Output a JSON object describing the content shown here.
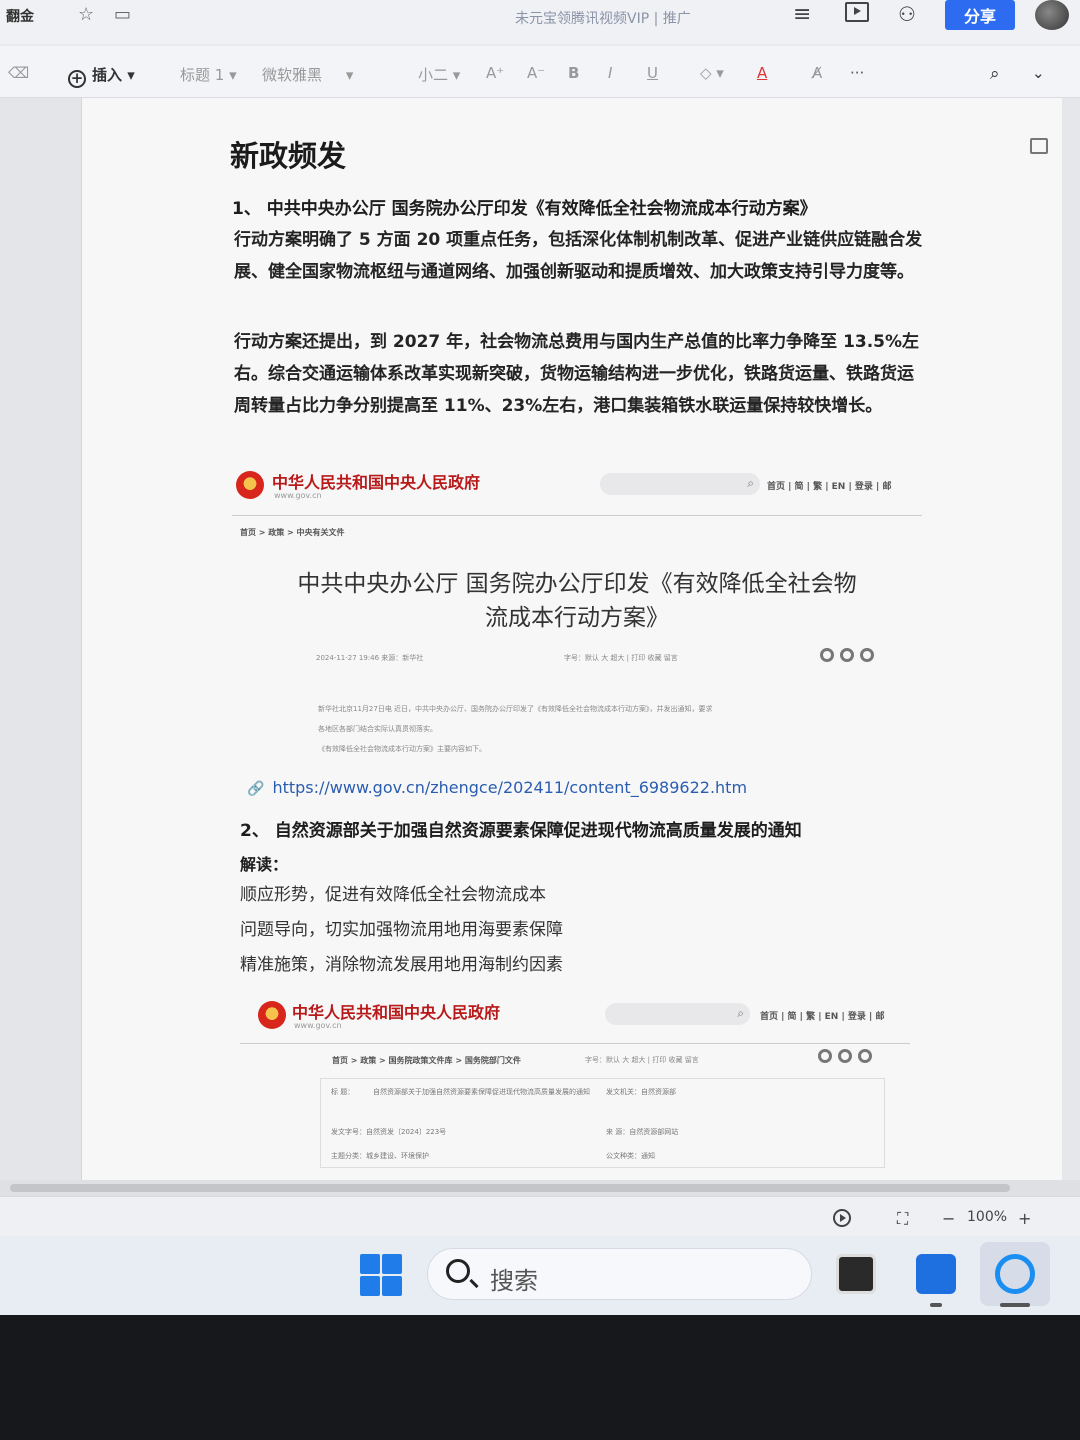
{
  "titlebar": {
    "doc_name": "翻金",
    "center_text": "未元宝领腾讯视频VIP  |  推广",
    "share_label": "分享"
  },
  "toolbar": {
    "insert_label": "插入",
    "style_label": "标题 1",
    "font_label": "微软雅黑",
    "size_label": "小二",
    "grow_font": "A⁺",
    "shrink_font": "A⁻",
    "bold": "B",
    "italic": "I",
    "underline": "U",
    "font_color": "A",
    "more": "···"
  },
  "document": {
    "heading": "新政频发",
    "item1_title": "1、 中共中央办公厅 国务院办公厅印发《有效降低全社会物流成本行动方案》",
    "item1_para1": "行动方案明确了 5 方面 20 项重点任务，包括深化体制机制改革、促进产业链供应链融合发展、健全国家物流枢纽与通道网络、加强创新驱动和提质增效、加大政策支持引导力度等。",
    "item1_para2": "行动方案还提出，到 2027 年，社会物流总费用与国内生产总值的比率力争降至 13.5%左右。综合交通运输体系改革实现新突破，货物运输结构进一步优化，铁路货运量、铁路货运周转量占比力争分别提高至 11%、23%左右，港口集装箱铁水联运量保持较快增长。",
    "gov1": {
      "site_title": "中华人民共和国中央人民政府",
      "site_sub": "www.gov.cn",
      "nav": "首页 | 简 | 繁 | EN | 登录 | 邮",
      "crumb": "首页 > 政策 > 中央有关文件",
      "article_title_line1": "中共中央办公厅 国务院办公厅印发《有效降低全社会物",
      "article_title_line2": "流成本行动方案》",
      "meta_left": "2024-11-27 19:46 来源：新华社",
      "meta_right": "字号：默认 大 超大  |  打印  收藏  留言",
      "body_line1": "新华社北京11月27日电 近日，中共中央办公厅、国务院办公厅印发了《有效降低全社会物流成本行动方案》，并发出通知，要求",
      "body_line2": "各地区各部门结合实际认真贯彻落实。",
      "body_line3": "《有效降低全社会物流成本行动方案》主要内容如下。"
    },
    "link": "https://www.gov.cn/zhengce/202411/content_6989622.htm",
    "item2_title": "2、 自然资源部关于加强自然资源要素保障促进现代物流高质量发展的通知",
    "jiedu_label": "解读：",
    "points": [
      "顺应形势，促进有效降低全社会物流成本",
      "问题导向，切实加强物流用地用海要素保障",
      "精准施策，消除物流发展用地用海制约因素"
    ],
    "gov2": {
      "site_title": "中华人民共和国中央人民政府",
      "site_sub": "www.gov.cn",
      "nav": "首页 | 简 | 繁 | EN | 登录 | 邮",
      "crumb": "首页 > 政策 > 国务院政策文件库 > 国务院部门文件",
      "meta_right": "字号：默认 大 超大  |  打印  收藏  留言",
      "row1_label": "标  题：",
      "row1_value": "自然资源部关于加强自然资源要素保障促进现代物流高质量发展的通知",
      "row1_right": "发文机关：自然资源部",
      "row2_left": "发文字号：自然资发〔2024〕223号",
      "row2_right": "来  源：自然资源部网站",
      "row3_left": "主题分类：城乡建设、环境保护",
      "row3_right": "公文种类：通知"
    }
  },
  "statusbar": {
    "zoom_minus": "−",
    "zoom_value": "100%",
    "zoom_plus": "+"
  },
  "taskbar": {
    "search_placeholder": "搜索"
  },
  "colors": {
    "share_button": "#2d6cf0",
    "gov_red": "#b81a1a",
    "link": "#2a5db0",
    "windows_blue": "#1f7ce8"
  }
}
